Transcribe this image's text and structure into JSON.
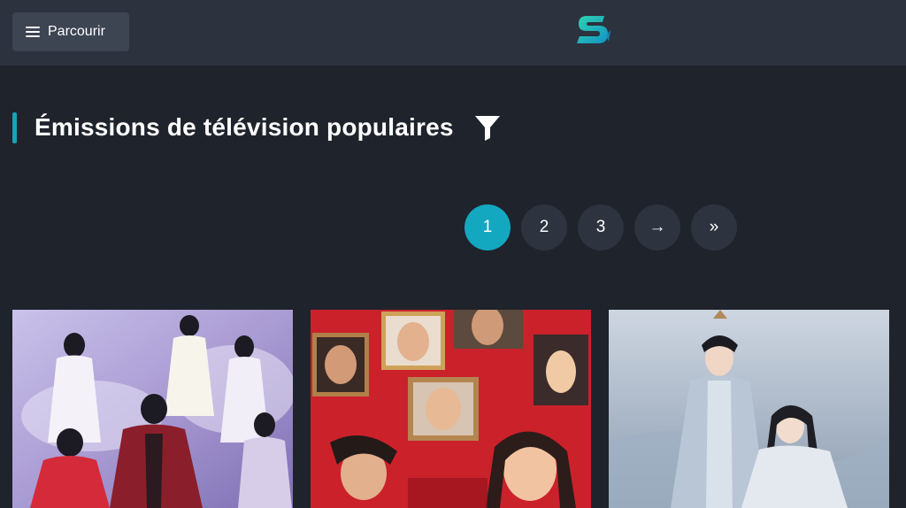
{
  "header": {
    "browse_label": "Parcourir",
    "logo_icon": "app-logo-s",
    "accent": "#14a7c0"
  },
  "section": {
    "title": "Émissions de télévision populaires",
    "filter_icon": "filter-icon"
  },
  "pagination": {
    "pages": [
      "1",
      "2",
      "3"
    ],
    "active": "1",
    "next": "→",
    "last": "»"
  },
  "shows": [
    {
      "poster_theme": "fantasy-pastel",
      "palette": [
        "#b8b0dc",
        "#e9e2f4",
        "#8a1f2b"
      ]
    },
    {
      "poster_theme": "red-portrait-wall",
      "palette": [
        "#d3242d",
        "#a81520",
        "#f2c19a"
      ]
    },
    {
      "poster_theme": "snowy-blue",
      "palette": [
        "#9aaabd",
        "#c6d1de",
        "#3c4757"
      ]
    }
  ]
}
